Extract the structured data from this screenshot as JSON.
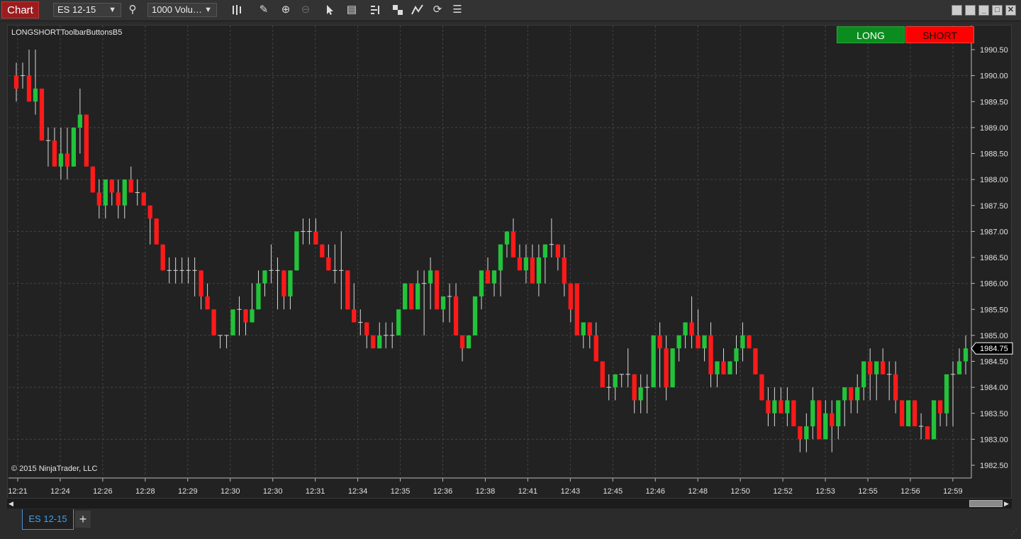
{
  "toolbar": {
    "chart_tab": "Chart",
    "instrument": "ES 12-15",
    "bar_type": "1000 Volu…",
    "icons": [
      "search-icon",
      "bar-style-icon",
      "pencil-icon",
      "zoom-in-icon",
      "zoom-out-icon",
      "pointer-icon",
      "data-box-icon",
      "indicators-icon",
      "strategies-icon",
      "drawing-tools-icon",
      "reload-icon",
      "properties-icon"
    ]
  },
  "window": {
    "controls": [
      "tile-icon",
      "tile-icon",
      "minimize-icon",
      "maximize-icon",
      "close-icon"
    ]
  },
  "chart": {
    "indicator_label": "LONGSHORTToolbarButtonsB5",
    "copyright": "© 2015 NinjaTrader, LLC",
    "long_button": "LONG",
    "short_button": "SHORT",
    "current_price": "1984.75",
    "colors": {
      "up": "#22c33a",
      "down": "#ff1a1a",
      "background": "#222222",
      "grid": "#444444",
      "wick": "#d9d9d9"
    }
  },
  "chart_data": {
    "type": "candlestick",
    "instrument": "ES 12-15",
    "ylim": [
      1982.5,
      1990.75
    ],
    "y_ticks": [
      "1990.50",
      "1990.00",
      "1989.50",
      "1989.00",
      "1988.50",
      "1988.00",
      "1987.50",
      "1987.00",
      "1986.50",
      "1986.00",
      "1985.50",
      "1985.00",
      "1984.50",
      "1984.00",
      "1983.50",
      "1983.00",
      "1982.50"
    ],
    "x_ticks": [
      "12:21",
      "12:24",
      "12:26",
      "12:28",
      "12:29",
      "12:30",
      "12:30",
      "12:31",
      "12:34",
      "12:35",
      "12:36",
      "12:38",
      "12:41",
      "12:43",
      "12:45",
      "12:46",
      "12:48",
      "12:50",
      "12:52",
      "12:53",
      "12:55",
      "12:56",
      "12:59"
    ],
    "candles": [
      [
        1990.0,
        1990.25,
        1989.5,
        1989.75
      ],
      [
        1990.0,
        1990.25,
        1989.75,
        1990.0
      ],
      [
        1990.0,
        1990.5,
        1989.5,
        1989.5
      ],
      [
        1989.5,
        1990.5,
        1989.25,
        1989.75
      ],
      [
        1989.75,
        1989.75,
        1988.75,
        1988.75
      ],
      [
        1988.75,
        1989.0,
        1988.25,
        1988.75
      ],
      [
        1988.75,
        1989.0,
        1988.25,
        1988.25
      ],
      [
        1988.25,
        1989.0,
        1988.0,
        1988.5
      ],
      [
        1988.5,
        1989.0,
        1988.0,
        1988.25
      ],
      [
        1988.25,
        1989.0,
        1988.25,
        1989.0
      ],
      [
        1989.0,
        1989.75,
        1988.5,
        1989.25
      ],
      [
        1989.25,
        1989.25,
        1988.25,
        1988.25
      ],
      [
        1988.25,
        1988.25,
        1987.75,
        1987.75
      ],
      [
        1987.75,
        1988.0,
        1987.25,
        1987.5
      ],
      [
        1987.5,
        1988.0,
        1987.25,
        1988.0
      ],
      [
        1988.0,
        1988.0,
        1987.5,
        1987.75
      ],
      [
        1987.75,
        1988.0,
        1987.25,
        1987.5
      ],
      [
        1987.5,
        1988.0,
        1987.25,
        1988.0
      ],
      [
        1988.0,
        1988.25,
        1987.75,
        1987.75
      ],
      [
        1987.75,
        1988.0,
        1987.5,
        1987.75
      ],
      [
        1987.75,
        1987.75,
        1987.5,
        1987.5
      ],
      [
        1987.5,
        1987.5,
        1986.75,
        1987.25
      ],
      [
        1987.25,
        1987.25,
        1986.75,
        1986.75
      ],
      [
        1986.75,
        1986.75,
        1986.25,
        1986.25
      ],
      [
        1986.25,
        1986.5,
        1986.0,
        1986.25
      ],
      [
        1986.25,
        1986.5,
        1986.0,
        1986.25
      ],
      [
        1986.25,
        1986.5,
        1986.0,
        1986.25
      ],
      [
        1986.25,
        1986.5,
        1986.0,
        1986.25
      ],
      [
        1986.25,
        1986.5,
        1985.75,
        1986.25
      ],
      [
        1986.25,
        1986.25,
        1985.5,
        1985.75
      ],
      [
        1985.75,
        1986.0,
        1985.5,
        1985.5
      ],
      [
        1985.5,
        1985.5,
        1985.0,
        1985.0
      ],
      [
        1985.0,
        1985.0,
        1984.75,
        1985.0
      ],
      [
        1985.0,
        1985.0,
        1984.75,
        1985.0
      ],
      [
        1985.0,
        1985.25,
        1985.0,
        1985.5
      ],
      [
        1985.5,
        1985.75,
        1985.0,
        1985.5
      ],
      [
        1985.5,
        1985.5,
        1985.0,
        1985.25
      ],
      [
        1985.25,
        1986.0,
        1985.25,
        1985.5
      ],
      [
        1985.5,
        1986.25,
        1985.5,
        1986.0
      ],
      [
        1986.0,
        1986.25,
        1985.75,
        1986.25
      ],
      [
        1986.25,
        1986.75,
        1986.0,
        1986.25
      ],
      [
        1986.25,
        1986.5,
        1985.5,
        1986.25
      ],
      [
        1986.25,
        1986.25,
        1985.5,
        1985.75
      ],
      [
        1985.75,
        1986.25,
        1985.5,
        1986.25
      ],
      [
        1986.25,
        1987.0,
        1986.25,
        1987.0
      ],
      [
        1987.0,
        1987.25,
        1986.75,
        1987.0
      ],
      [
        1987.0,
        1987.25,
        1986.75,
        1987.0
      ],
      [
        1987.0,
        1987.25,
        1986.75,
        1986.75
      ],
      [
        1986.75,
        1986.75,
        1986.5,
        1986.5
      ],
      [
        1986.5,
        1986.75,
        1986.25,
        1986.25
      ],
      [
        1986.25,
        1986.75,
        1986.0,
        1986.25
      ],
      [
        1986.25,
        1987.0,
        1985.5,
        1986.25
      ],
      [
        1986.25,
        1986.25,
        1985.5,
        1985.5
      ],
      [
        1985.5,
        1986.0,
        1985.25,
        1985.25
      ],
      [
        1985.25,
        1985.5,
        1985.0,
        1985.25
      ],
      [
        1985.25,
        1985.25,
        1984.75,
        1985.0
      ],
      [
        1985.0,
        1985.0,
        1984.75,
        1984.75
      ],
      [
        1984.75,
        1985.25,
        1984.75,
        1985.0
      ],
      [
        1985.0,
        1985.25,
        1984.75,
        1985.0
      ],
      [
        1985.0,
        1985.25,
        1984.75,
        1985.0
      ],
      [
        1985.0,
        1985.5,
        1985.0,
        1985.5
      ],
      [
        1985.5,
        1986.0,
        1985.5,
        1986.0
      ],
      [
        1986.0,
        1986.0,
        1985.5,
        1985.5
      ],
      [
        1985.5,
        1986.25,
        1985.5,
        1986.0
      ],
      [
        1986.0,
        1986.25,
        1985.0,
        1986.0
      ],
      [
        1986.0,
        1986.5,
        1985.5,
        1986.25
      ],
      [
        1986.25,
        1986.25,
        1985.5,
        1985.5
      ],
      [
        1985.5,
        1985.75,
        1985.25,
        1985.75
      ],
      [
        1985.75,
        1986.0,
        1985.25,
        1985.75
      ],
      [
        1985.75,
        1986.0,
        1985.0,
        1985.0
      ],
      [
        1985.0,
        1985.0,
        1984.5,
        1984.75
      ],
      [
        1984.75,
        1985.0,
        1984.75,
        1985.0
      ],
      [
        1985.0,
        1985.75,
        1985.0,
        1985.75
      ],
      [
        1985.75,
        1986.0,
        1985.5,
        1986.25
      ],
      [
        1986.25,
        1986.5,
        1986.0,
        1986.0
      ],
      [
        1986.0,
        1986.25,
        1985.75,
        1986.25
      ],
      [
        1986.25,
        1986.75,
        1985.75,
        1986.75
      ],
      [
        1986.75,
        1987.0,
        1986.5,
        1987.0
      ],
      [
        1987.0,
        1987.25,
        1986.5,
        1986.5
      ],
      [
        1986.5,
        1986.75,
        1986.25,
        1986.25
      ],
      [
        1986.25,
        1986.75,
        1986.0,
        1986.5
      ],
      [
        1986.5,
        1986.75,
        1986.0,
        1986.0
      ],
      [
        1986.0,
        1986.75,
        1985.75,
        1986.5
      ],
      [
        1986.5,
        1986.75,
        1986.0,
        1986.75
      ],
      [
        1986.75,
        1987.25,
        1986.5,
        1986.75
      ],
      [
        1986.75,
        1986.75,
        1986.25,
        1986.5
      ],
      [
        1986.5,
        1986.75,
        1985.75,
        1986.0
      ],
      [
        1986.0,
        1986.0,
        1985.25,
        1985.5
      ],
      [
        1986.0,
        1986.0,
        1985.0,
        1985.0
      ],
      [
        1985.0,
        1985.25,
        1984.75,
        1985.25
      ],
      [
        1985.25,
        1985.25,
        1984.75,
        1985.0
      ],
      [
        1985.0,
        1985.25,
        1984.5,
        1984.5
      ],
      [
        1984.5,
        1984.5,
        1984.0,
        1984.0
      ],
      [
        1984.0,
        1984.25,
        1983.75,
        1984.0
      ],
      [
        1984.0,
        1984.25,
        1983.75,
        1984.25
      ],
      [
        1984.25,
        1984.25,
        1984.0,
        1984.25
      ],
      [
        1984.25,
        1984.75,
        1984.0,
        1984.25
      ],
      [
        1984.25,
        1984.25,
        1983.5,
        1983.75
      ],
      [
        1983.75,
        1984.25,
        1983.5,
        1984.0
      ],
      [
        1984.0,
        1984.25,
        1983.5,
        1984.0
      ],
      [
        1984.0,
        1985.0,
        1984.0,
        1985.0
      ],
      [
        1985.0,
        1985.25,
        1984.0,
        1984.75
      ],
      [
        1984.75,
        1985.0,
        1983.75,
        1984.0
      ],
      [
        1984.0,
        1984.75,
        1984.0,
        1984.75
      ],
      [
        1984.75,
        1985.0,
        1984.5,
        1985.0
      ],
      [
        1985.0,
        1985.25,
        1984.75,
        1985.25
      ],
      [
        1985.25,
        1985.75,
        1984.75,
        1985.0
      ],
      [
        1985.0,
        1985.5,
        1984.75,
        1984.75
      ],
      [
        1984.75,
        1985.0,
        1984.5,
        1985.0
      ],
      [
        1985.0,
        1985.25,
        1984.0,
        1984.25
      ],
      [
        1984.25,
        1984.5,
        1984.0,
        1984.5
      ],
      [
        1984.5,
        1984.75,
        1984.25,
        1984.25
      ],
      [
        1984.25,
        1984.5,
        1984.25,
        1984.5
      ],
      [
        1984.5,
        1985.0,
        1984.25,
        1984.75
      ],
      [
        1984.75,
        1985.25,
        1984.5,
        1985.0
      ],
      [
        1985.0,
        1985.0,
        1984.75,
        1984.75
      ],
      [
        1984.75,
        1984.75,
        1984.25,
        1984.25
      ],
      [
        1984.25,
        1984.25,
        1983.75,
        1983.75
      ],
      [
        1983.75,
        1984.0,
        1983.25,
        1983.5
      ],
      [
        1983.5,
        1984.0,
        1983.25,
        1983.75
      ],
      [
        1983.75,
        1984.0,
        1983.5,
        1983.5
      ],
      [
        1983.5,
        1984.0,
        1983.25,
        1983.75
      ],
      [
        1983.75,
        1983.75,
        1983.25,
        1983.25
      ],
      [
        1983.25,
        1983.25,
        1982.75,
        1983.0
      ],
      [
        1983.0,
        1983.5,
        1982.75,
        1983.25
      ],
      [
        1983.25,
        1984.0,
        1983.0,
        1983.75
      ],
      [
        1983.75,
        1983.75,
        1983.0,
        1983.0
      ],
      [
        1983.0,
        1983.75,
        1983.0,
        1983.5
      ],
      [
        1983.5,
        1983.75,
        1982.75,
        1983.25
      ],
      [
        1983.25,
        1983.75,
        1983.0,
        1983.75
      ],
      [
        1983.75,
        1984.0,
        1983.25,
        1984.0
      ],
      [
        1984.0,
        1984.0,
        1983.5,
        1983.75
      ],
      [
        1983.75,
        1984.25,
        1983.5,
        1984.0
      ],
      [
        1984.0,
        1984.5,
        1983.75,
        1984.5
      ],
      [
        1984.5,
        1984.75,
        1983.75,
        1984.25
      ],
      [
        1984.25,
        1984.5,
        1983.75,
        1984.5
      ],
      [
        1984.5,
        1984.75,
        1984.25,
        1984.25
      ],
      [
        1984.25,
        1984.5,
        1983.75,
        1984.25
      ],
      [
        1984.25,
        1984.5,
        1983.5,
        1983.75
      ],
      [
        1983.75,
        1983.75,
        1983.25,
        1983.25
      ],
      [
        1983.25,
        1983.75,
        1983.25,
        1983.75
      ],
      [
        1983.75,
        1983.75,
        1983.25,
        1983.25
      ],
      [
        1983.25,
        1983.5,
        1983.0,
        1983.25
      ],
      [
        1983.25,
        1983.25,
        1983.0,
        1983.0
      ],
      [
        1983.0,
        1983.75,
        1983.0,
        1983.75
      ],
      [
        1983.75,
        1983.75,
        1983.25,
        1983.5
      ],
      [
        1983.5,
        1984.0,
        1983.25,
        1984.25
      ],
      [
        1984.25,
        1984.5,
        1983.25,
        1984.25
      ],
      [
        1984.25,
        1984.75,
        1984.25,
        1984.5
      ],
      [
        1984.5,
        1985.0,
        1984.25,
        1984.75
      ]
    ]
  }
}
